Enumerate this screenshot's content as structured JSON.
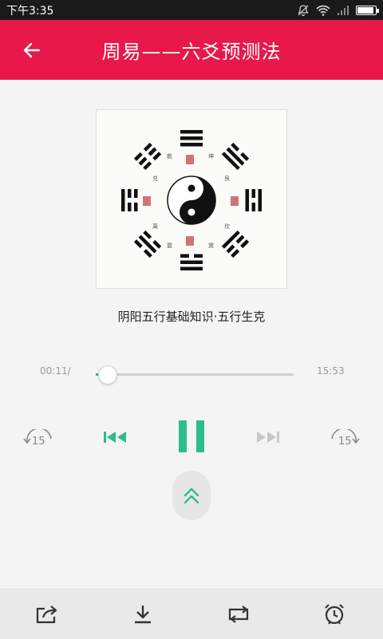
{
  "status_bar": {
    "time": "下午3:35",
    "icons": [
      "mute-icon",
      "wifi-icon",
      "signal-icon",
      "battery-icon"
    ],
    "battery_level": 0.9
  },
  "app_bar": {
    "title": "周易——六爻预测法",
    "back_icon": "arrow-left-icon"
  },
  "cover": {
    "image_description_icon": "bagua-yinyang-image"
  },
  "track": {
    "title": "阴阳五行基础知识·五行生克"
  },
  "player": {
    "current_time": "00:11/",
    "total_time": "15:53",
    "progress": 0.012,
    "rewind_label": "15",
    "forward_label": "15",
    "state": "playing"
  },
  "bottom_bar": {
    "items": [
      "share-icon",
      "download-icon",
      "repeat-icon",
      "alarm-icon"
    ]
  },
  "colors": {
    "accent": "#e8184a",
    "play": "#2dbd8a",
    "muted": "#c8c8c8",
    "icon": "#333333"
  }
}
